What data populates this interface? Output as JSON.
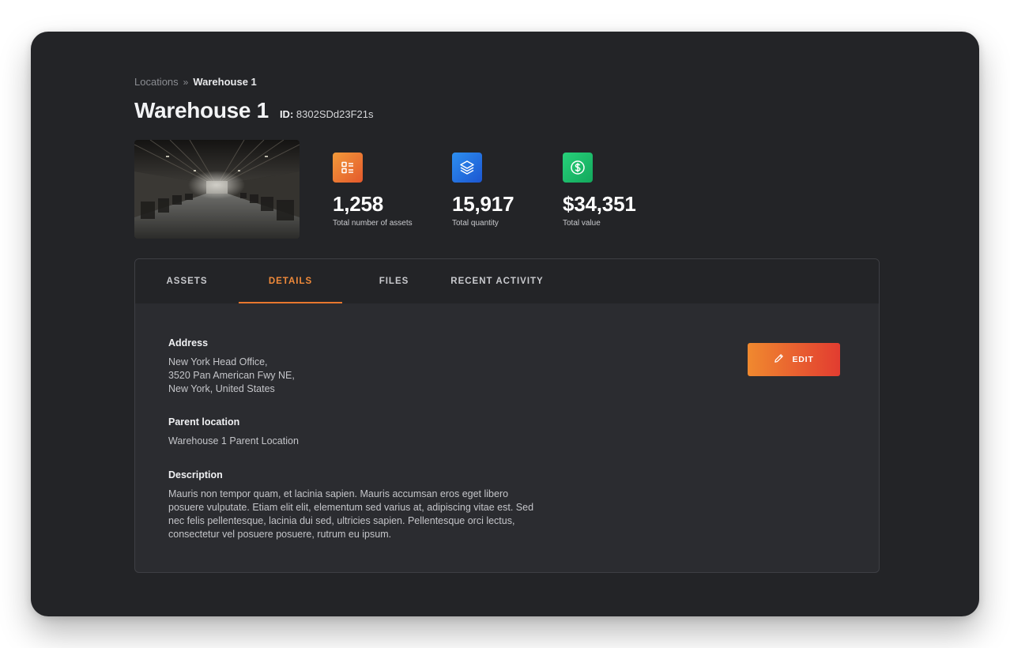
{
  "breadcrumb": {
    "parent": "Locations",
    "separator": "»",
    "current": "Warehouse 1"
  },
  "header": {
    "title": "Warehouse 1",
    "id_label": "ID:",
    "id_value": "8302SDd23F21s"
  },
  "stats": [
    {
      "icon": "list-icon",
      "color": "#ec6f30",
      "value": "1,258",
      "label": "Total number of assets"
    },
    {
      "icon": "layers-icon",
      "color": "#2474e0",
      "value": "15,917",
      "label": "Total quantity"
    },
    {
      "icon": "dollar-icon",
      "color": "#1cbf6b",
      "value": "$34,351",
      "label": "Total value"
    }
  ],
  "tabs": [
    {
      "label": "ASSETS",
      "active": false
    },
    {
      "label": "DETAILS",
      "active": true
    },
    {
      "label": "FILES",
      "active": false
    },
    {
      "label": "RECENT ACTIVITY",
      "active": false
    }
  ],
  "details": {
    "address": {
      "title": "Address",
      "lines": [
        "New York Head Office,",
        "3520 Pan American Fwy NE,",
        "New York, United States"
      ]
    },
    "parent_location": {
      "title": "Parent location",
      "value": "Warehouse 1 Parent Location"
    },
    "description": {
      "title": "Description",
      "lines": [
        "Mauris non tempor quam, et lacinia sapien. Mauris accumsan eros eget libero",
        "posuere vulputate. Etiam elit elit, elementum sed varius at, adipiscing vitae est. Sed",
        "nec felis pellentesque, lacinia dui sed, ultricies sapien. Pellentesque orci lectus,",
        "consectetur vel posuere posuere, rutrum eu ipsum."
      ]
    },
    "edit_button": {
      "label": "EDIT",
      "icon": "pencil-icon"
    }
  },
  "colors": {
    "accent": "#e8772e",
    "background": "#232427",
    "card": "#2b2c30"
  }
}
